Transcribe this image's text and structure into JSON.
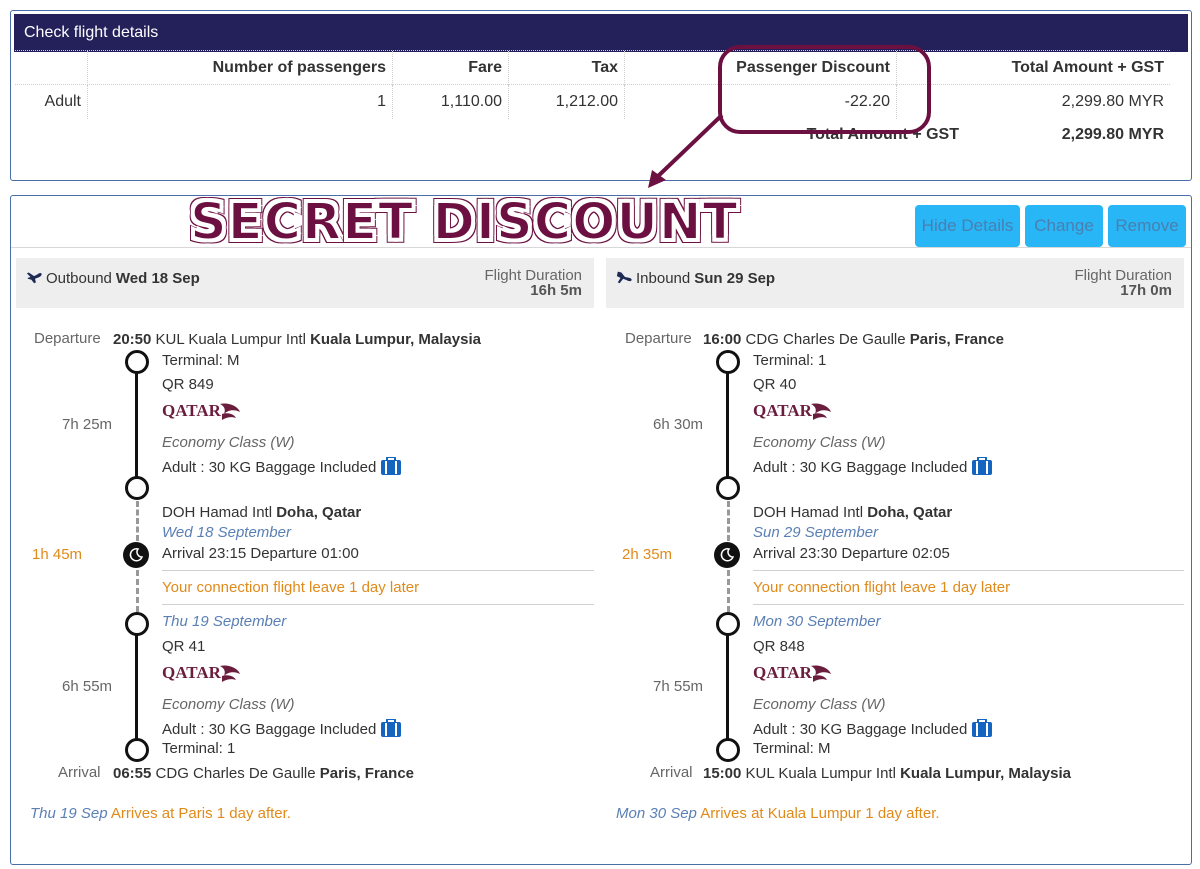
{
  "header": {
    "title": "Check flight details"
  },
  "price_table": {
    "columns": [
      "Number of passengers",
      "Fare",
      "Tax",
      "Passenger Discount",
      "Total Amount + GST"
    ],
    "rows": [
      {
        "type": "Adult",
        "passengers": "1",
        "fare": "1,110.00",
        "tax": "1,212.00",
        "discount": "-22.20",
        "total": "2,299.80 MYR"
      }
    ],
    "total_label": "Total Amount + GST",
    "total_value": "2,299.80 MYR"
  },
  "annotation": {
    "text": "SECRET DISCOUNT",
    "color": "#6b1040"
  },
  "buttons": {
    "hide": "Hide Details",
    "change": "Change",
    "remove": "Remove"
  },
  "outbound": {
    "direction": "Outbound",
    "date": "Wed 18 Sep",
    "duration_label": "Flight Duration",
    "duration": "16h 5m",
    "departure_label": "Departure",
    "dep_time": "20:50",
    "dep_airport": "KUL Kuala Lumpur Intl",
    "dep_city": "Kuala Lumpur, Malaysia",
    "seg1": {
      "terminal": "Terminal: M",
      "flight": "QR 849",
      "duration": "7h 25m",
      "cabin": "Economy Class (W)",
      "baggage": "Adult : 30 KG Baggage Included"
    },
    "stop": {
      "airport": "DOH Hamad Intl",
      "city": "Doha, Qatar",
      "date": "Wed 18 September",
      "layover": "1h 45m",
      "times": "Arrival 23:15 Departure 01:00",
      "note": "Your connection flight leave 1 day later",
      "next_date": "Thu 19 September"
    },
    "seg2": {
      "flight": "QR 41",
      "duration": "6h 55m",
      "cabin": "Economy Class (W)",
      "baggage": "Adult : 30 KG Baggage Included",
      "terminal": "Terminal: 1"
    },
    "arrival_label": "Arrival",
    "arr_time": "06:55",
    "arr_airport": "CDG Charles De Gaulle",
    "arr_city": "Paris, France",
    "footer_date": "Thu 19 Sep",
    "footer_note": "Arrives at Paris 1 day after."
  },
  "inbound": {
    "direction": "Inbound",
    "date": "Sun 29 Sep",
    "duration_label": "Flight Duration",
    "duration": "17h 0m",
    "departure_label": "Departure",
    "dep_time": "16:00",
    "dep_airport": "CDG Charles De Gaulle",
    "dep_city": "Paris, France",
    "seg1": {
      "terminal": "Terminal: 1",
      "flight": "QR 40",
      "duration": "6h 30m",
      "cabin": "Economy Class (W)",
      "baggage": "Adult : 30 KG Baggage Included"
    },
    "stop": {
      "airport": "DOH Hamad Intl",
      "city": "Doha, Qatar",
      "date": "Sun 29 September",
      "layover": "2h 35m",
      "times": "Arrival 23:30 Departure 02:05",
      "note": "Your connection flight leave 1 day later",
      "next_date": "Mon 30 September"
    },
    "seg2": {
      "flight": "QR 848",
      "duration": "7h 55m",
      "cabin": "Economy Class (W)",
      "baggage": "Adult : 30 KG Baggage Included",
      "terminal": "Terminal: M"
    },
    "arrival_label": "Arrival",
    "arr_time": "15:00",
    "arr_airport": "KUL Kuala Lumpur Intl",
    "arr_city": "Kuala Lumpur, Malaysia",
    "footer_date": "Mon 30 Sep",
    "footer_note": "Arrives at Kuala Lumpur 1 day after."
  },
  "airline_logo": "QATAR"
}
